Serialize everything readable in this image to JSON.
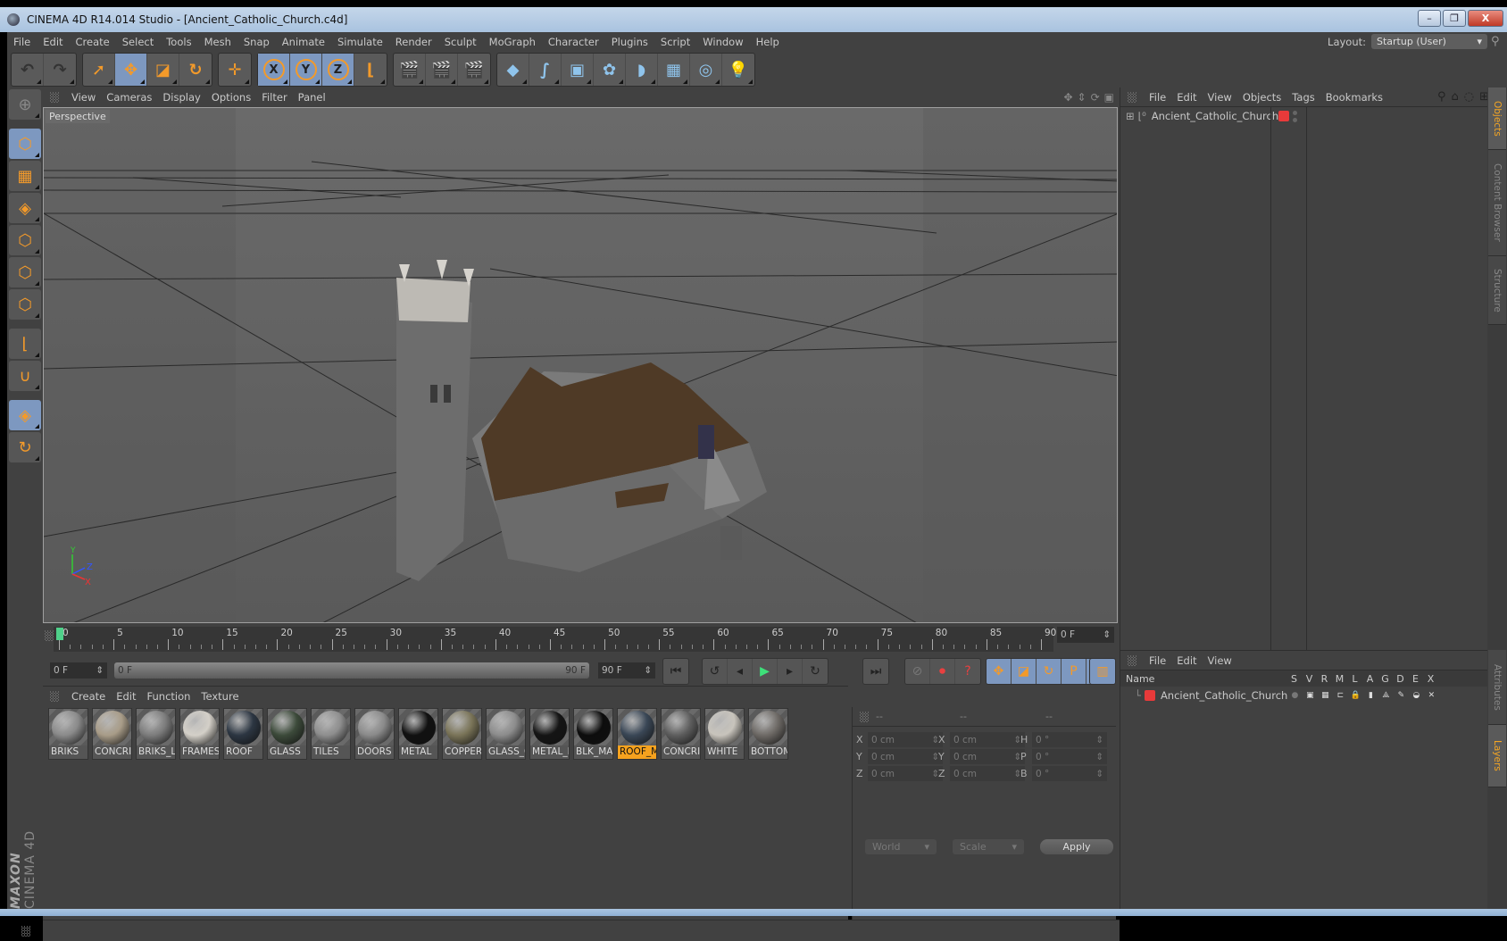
{
  "window": {
    "title": "CINEMA 4D R14.014 Studio - [Ancient_Catholic_Church.c4d]",
    "controls": {
      "minimize": "–",
      "restore": "❐",
      "close": "X"
    }
  },
  "menubar": {
    "items": [
      "File",
      "Edit",
      "Create",
      "Select",
      "Tools",
      "Mesh",
      "Snap",
      "Animate",
      "Simulate",
      "Render",
      "Sculpt",
      "MoGraph",
      "Character",
      "Plugins",
      "Script",
      "Window",
      "Help"
    ],
    "layout_label": "Layout:",
    "layout_value": "Startup (User)"
  },
  "toolbar": {
    "groups": [
      [
        {
          "name": "undo-icon",
          "glyph": "↶"
        },
        {
          "name": "redo-icon",
          "glyph": "↷"
        }
      ],
      [
        {
          "name": "live-selection-icon",
          "glyph": "➚"
        },
        {
          "name": "move-icon",
          "glyph": "✥",
          "active": true
        },
        {
          "name": "scale-icon",
          "glyph": "◪"
        },
        {
          "name": "rotate-icon",
          "glyph": "↻"
        }
      ],
      [
        {
          "name": "add-icon",
          "glyph": "✛"
        }
      ],
      [
        {
          "name": "x-axis-icon",
          "glyph": "X",
          "active": true
        },
        {
          "name": "y-axis-icon",
          "glyph": "Y",
          "active": true
        },
        {
          "name": "z-axis-icon",
          "glyph": "Z",
          "active": true
        },
        {
          "name": "coordinate-system-icon",
          "glyph": "⌊"
        }
      ],
      [
        {
          "name": "render-view-icon",
          "glyph": "🎬"
        },
        {
          "name": "render-picture-viewer-icon",
          "glyph": "🎬"
        },
        {
          "name": "render-settings-icon",
          "glyph": "🎬"
        }
      ],
      [
        {
          "name": "cube-icon",
          "glyph": "◆"
        },
        {
          "name": "spline-icon",
          "glyph": "∫"
        },
        {
          "name": "subdivision-icon",
          "glyph": "▣"
        },
        {
          "name": "mograph-cloner-icon",
          "glyph": "✿"
        },
        {
          "name": "deformer-icon",
          "glyph": "◗"
        },
        {
          "name": "floor-icon",
          "glyph": "▦"
        },
        {
          "name": "camera-icon",
          "glyph": "◎"
        },
        {
          "name": "light-icon",
          "glyph": "💡"
        }
      ]
    ]
  },
  "sidebar": {
    "tools": [
      {
        "name": "make-editable-icon",
        "glyph": "⊕"
      },
      {
        "name": "model-mode-icon",
        "glyph": "⬡",
        "active": true
      },
      {
        "name": "texture-mode-icon",
        "glyph": "▦"
      },
      {
        "name": "workplane-mode-icon",
        "glyph": "◈"
      },
      {
        "name": "points-mode-icon",
        "glyph": "⬡"
      },
      {
        "name": "edges-mode-icon",
        "glyph": "⬡"
      },
      {
        "name": "polygons-mode-icon",
        "glyph": "⬡"
      },
      {
        "name": "axis-mode-icon",
        "glyph": "⌊"
      },
      {
        "name": "snap-icon",
        "glyph": "∪"
      },
      {
        "name": "locked-workplane-icon",
        "glyph": "◈",
        "active": true
      },
      {
        "name": "planar-workplane-icon",
        "glyph": "↻"
      }
    ],
    "logo_brand": "MAXON",
    "logo_product": "CINEMA 4D"
  },
  "viewport": {
    "menu": [
      "View",
      "Cameras",
      "Display",
      "Options",
      "Filter",
      "Panel"
    ],
    "label": "Perspective",
    "axis": {
      "x": "X",
      "y": "Y",
      "z": "Z"
    }
  },
  "timeline": {
    "ticks": [
      "0",
      "5",
      "10",
      "15",
      "20",
      "25",
      "30",
      "35",
      "40",
      "45",
      "50",
      "55",
      "60",
      "65",
      "70",
      "75",
      "80",
      "85",
      "90"
    ],
    "current_frame": "0 F",
    "start_field": "0 F",
    "range_start": "0 F",
    "range_end": "90 F",
    "end_field": "90 F",
    "playhead_fraction": 0
  },
  "transport": {
    "buttons": [
      {
        "name": "go-to-start-icon",
        "glyph": "⏮"
      },
      {
        "name": "go-to-previous-key-icon",
        "glyph": "↺"
      },
      {
        "name": "previous-frame-icon",
        "glyph": "◂"
      },
      {
        "name": "play-icon",
        "glyph": "▶"
      },
      {
        "name": "next-frame-icon",
        "glyph": "▸"
      },
      {
        "name": "go-to-next-key-icon",
        "glyph": "↻"
      },
      {
        "name": "go-to-end-icon",
        "glyph": "⏭"
      }
    ],
    "key_buttons": [
      {
        "name": "record-disabled-icon",
        "glyph": "⊘"
      },
      {
        "name": "autokey-icon",
        "glyph": "⏺"
      },
      {
        "name": "key-help-icon",
        "glyph": "?"
      }
    ],
    "key_tracks": [
      {
        "name": "key-position-icon",
        "glyph": "✥"
      },
      {
        "name": "key-scale-icon",
        "glyph": "◪"
      },
      {
        "name": "key-rotation-icon",
        "glyph": "↻"
      },
      {
        "name": "key-parameter-icon",
        "glyph": "P"
      },
      {
        "name": "key-pla-icon",
        "glyph": "⁞⁞"
      }
    ],
    "timeline_button": {
      "name": "timeline-film-icon",
      "glyph": "▥"
    }
  },
  "materials": {
    "menu": [
      "Create",
      "Edit",
      "Function",
      "Texture"
    ],
    "items": [
      {
        "label": "BRIKS",
        "color": "#8a8a8a"
      },
      {
        "label": "CONCRI",
        "color": "#a89c88"
      },
      {
        "label": "BRIKS_LI",
        "color": "#7c7c7c"
      },
      {
        "label": "FRAMES",
        "color": "#d4d0c8"
      },
      {
        "label": "ROOF",
        "color": "#2c3642"
      },
      {
        "label": "GLASS",
        "color": "#3c4a3a"
      },
      {
        "label": "TILES",
        "color": "#8e8e8e"
      },
      {
        "label": "DOORS",
        "color": "#8a8a8a"
      },
      {
        "label": "METAL",
        "color": "#111111"
      },
      {
        "label": "COPPER",
        "color": "#7a7458"
      },
      {
        "label": "GLASS_C",
        "color": "#8c8c8c"
      },
      {
        "label": "METAL_I",
        "color": "#151515"
      },
      {
        "label": "BLK_MA",
        "color": "#0d0d0d"
      },
      {
        "label": "ROOF_M",
        "color": "#3a4756",
        "selected": true
      },
      {
        "label": "CONCRI",
        "color": "#5e5e5e"
      },
      {
        "label": "WHITE",
        "color": "#c8c4bc"
      },
      {
        "label": "BOTTOM",
        "color": "#6e6a66"
      }
    ]
  },
  "coordinates": {
    "headers": [
      "--",
      "--",
      "--"
    ],
    "position": [
      {
        "axis": "X",
        "value": "0 cm"
      },
      {
        "axis": "Y",
        "value": "0 cm"
      },
      {
        "axis": "Z",
        "value": "0 cm"
      }
    ],
    "size": [
      {
        "axis": "X",
        "value": "0 cm"
      },
      {
        "axis": "Y",
        "value": "0 cm"
      },
      {
        "axis": "Z",
        "value": "0 cm"
      }
    ],
    "rotation": [
      {
        "axis": "H",
        "value": "0 °"
      },
      {
        "axis": "P",
        "value": "0 °"
      },
      {
        "axis": "B",
        "value": "0 °"
      }
    ],
    "space": "World",
    "mode": "Scale",
    "apply": "Apply"
  },
  "objects_panel": {
    "menu": [
      "File",
      "Edit",
      "View",
      "Objects",
      "Tags",
      "Bookmarks"
    ],
    "objects": [
      {
        "name": "Ancient_Catholic_Church",
        "layer_color": "#e83a3a"
      }
    ],
    "tabs": [
      {
        "label": "Objects",
        "active": true
      },
      {
        "label": "Content Browser"
      },
      {
        "label": "Structure"
      }
    ]
  },
  "layers_panel": {
    "menu": [
      "File",
      "Edit",
      "View"
    ],
    "columns": [
      "Name",
      "S",
      "V",
      "R",
      "M",
      "L",
      "A",
      "G",
      "D",
      "E",
      "X"
    ],
    "layers": [
      {
        "name": "Ancient_Catholic_Church",
        "color": "#e83a3a"
      }
    ],
    "tabs": [
      {
        "label": "Attributes"
      },
      {
        "label": "Layers",
        "active": true
      }
    ]
  }
}
